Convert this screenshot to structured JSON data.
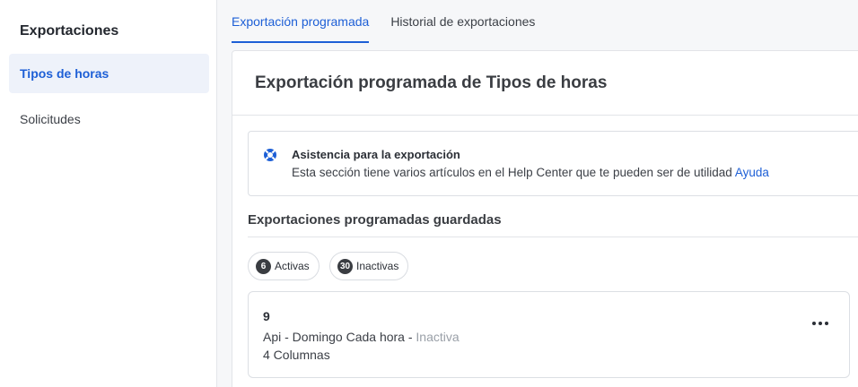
{
  "sidebar": {
    "title": "Exportaciones",
    "items": [
      {
        "label": "Tipos de horas",
        "active": true
      },
      {
        "label": "Solicitudes",
        "active": false
      }
    ]
  },
  "tabs": [
    {
      "label": "Exportación programada",
      "active": true
    },
    {
      "label": "Historial de exportaciones",
      "active": false
    }
  ],
  "panel": {
    "title": "Exportación programada de Tipos de horas",
    "assistance": {
      "icon": "lifebuoy-icon",
      "title": "Asistencia para la exportación",
      "text": "Esta sección tiene varios artículos en el Help Center que te pueden ser de utilidad",
      "link": "Ayuda"
    },
    "saved_title": "Exportaciones programadas guardadas",
    "filters": [
      {
        "count": "6",
        "label": "Activas"
      },
      {
        "count": "30",
        "label": "Inactivas"
      }
    ],
    "exports": [
      {
        "name": "9",
        "description": "Api - Domingo Cada hora - ",
        "status": "Inactiva",
        "columns": "4 Columnas",
        "menu_icon": "more-horizontal-icon"
      }
    ]
  },
  "colors": {
    "accent": "#1d5fd6",
    "muted_status": "#9aa0a8",
    "active_bg": "#eef2fa"
  }
}
